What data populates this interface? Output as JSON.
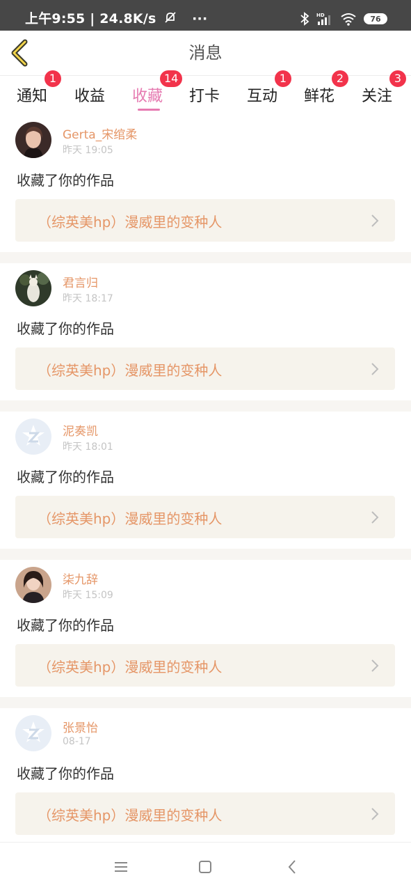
{
  "status_bar": {
    "time_speed": "上午9:55 | 24.8K/s",
    "more": "···",
    "battery": "76",
    "icons": [
      "mute-bell-icon",
      "bluetooth-icon",
      "hd-signal-icon",
      "wifi-icon",
      "battery-icon"
    ]
  },
  "header": {
    "title": "消息",
    "back_icon": "back-chevron-icon"
  },
  "tabs": [
    {
      "label": "通知",
      "badge": "1"
    },
    {
      "label": "收益",
      "badge": ""
    },
    {
      "label": "收藏",
      "badge": "14",
      "active": true
    },
    {
      "label": "打卡",
      "badge": ""
    },
    {
      "label": "互动",
      "badge": "1"
    },
    {
      "label": "鲜花",
      "badge": "2"
    },
    {
      "label": "关注",
      "badge": "3"
    }
  ],
  "items": [
    {
      "user": "Gerta_宋绾柔",
      "time": "昨天 19:05",
      "action": "收藏了你的作品",
      "work": "（综英美hp）漫威里的变种人"
    },
    {
      "user": "君言归",
      "time": "昨天 18:17",
      "action": "收藏了你的作品",
      "work": "（综英美hp）漫威里的变种人"
    },
    {
      "user": "泥奏凯",
      "time": "昨天 18:01",
      "action": "收藏了你的作品",
      "work": "（综英美hp）漫威里的变种人"
    },
    {
      "user": "柒九辞",
      "time": "昨天 15:09",
      "action": "收藏了你的作品",
      "work": "（综英美hp）漫威里的变种人"
    },
    {
      "user": "张景怡",
      "time": "08-17",
      "action": "收藏了你的作品",
      "work": "（综英美hp）漫威里的变种人"
    }
  ],
  "colors": {
    "accent_pink": "#e67ab1",
    "name_orange": "#e59667",
    "badge_red": "#f2334b",
    "card_bg": "#f6f3ec"
  },
  "nav": {
    "icons": [
      "menu-icon",
      "home-square-icon",
      "back-triangle-icon"
    ]
  }
}
